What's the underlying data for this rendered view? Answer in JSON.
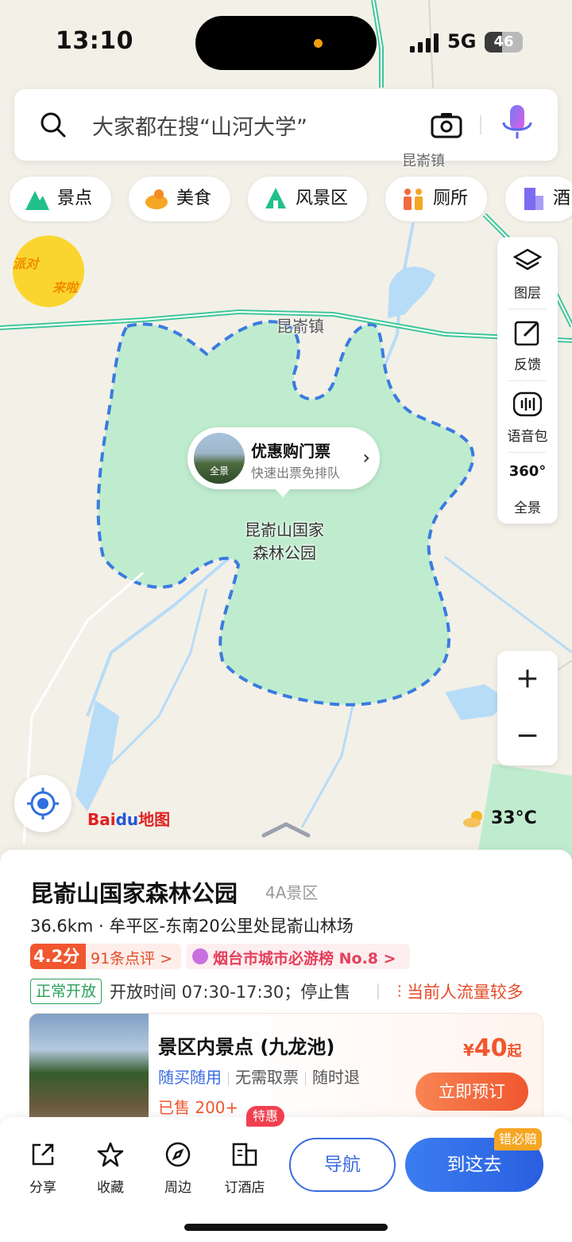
{
  "status_bar": {
    "time": "13:10",
    "network": "5G",
    "battery": "46",
    "battery_level": 0.46
  },
  "search": {
    "placeholder": "大家都在搜“山河大学”",
    "icons": [
      "search-icon",
      "camera-icon",
      "microphone-icon"
    ]
  },
  "categories": [
    {
      "label": "景点",
      "icon": "mountain-icon",
      "color": "#21c08b"
    },
    {
      "label": "美食",
      "icon": "food-icon",
      "color": "#f5a623"
    },
    {
      "label": "风景区",
      "icon": "scenic-icon",
      "color": "#21c08b"
    },
    {
      "label": "厕所",
      "icon": "restroom-icon",
      "color": "#f26a3c"
    },
    {
      "label": "酒",
      "icon": "hotel-icon",
      "color": "#7b6cf0"
    }
  ],
  "promo_badge": {
    "line1": "派对",
    "line2": "来啦"
  },
  "map_tools": [
    {
      "label": "图层",
      "icon": "layers-icon"
    },
    {
      "label": "反馈",
      "icon": "feedback-icon"
    },
    {
      "label": "语音包",
      "icon": "voice-pack-icon"
    },
    {
      "label": "全景",
      "icon": "panorama-360-icon",
      "glyph": "360°"
    }
  ],
  "zoom": {
    "in": "+",
    "out": "−"
  },
  "map": {
    "town_label": "昆嵛镇",
    "park_label_line1": "昆嵛山国家",
    "park_label_line2": "森林公园",
    "top_label": "昆嵛镇",
    "logo": {
      "part1": "Bai",
      "part2": "du",
      "part3": "地图"
    },
    "weather": "33°C",
    "colors": {
      "park": "#bfeccf",
      "water": "#b7dcf7",
      "road": "#3fc79a",
      "boundary": "#3a7be0"
    }
  },
  "ticket_bubble": {
    "title": "优惠购门票",
    "subtitle": "快速出票免排队",
    "thumb_label": "全景"
  },
  "place": {
    "name": "昆嵛山国家森林公园",
    "grade": "4A景区",
    "address": "36.6km · 牟平区-东南20公里处昆嵛山林场",
    "score": "4.2分",
    "reviews": "91条点评 >",
    "rank": "烟台市城市必游榜 No.8 >",
    "open_status": "正常开放",
    "hours": "开放时间 07:30-17:30；停止售",
    "crowd": "当前人流量较多"
  },
  "ticket": {
    "title": "景区内景点 (九龙池)",
    "tag1": "随买随用",
    "tag2": "无需取票",
    "tag3": "随时退",
    "sold": "已售 200+",
    "currency": "¥",
    "price": "40",
    "price_suffix": "起",
    "book_label": "立即预订"
  },
  "actions": {
    "share": "分享",
    "favorite": "收藏",
    "nearby": "周边",
    "hotel": "订酒店",
    "hotel_badge": "特惠",
    "navigate": "导航",
    "go": "到这去",
    "go_badge": "错必赔"
  }
}
